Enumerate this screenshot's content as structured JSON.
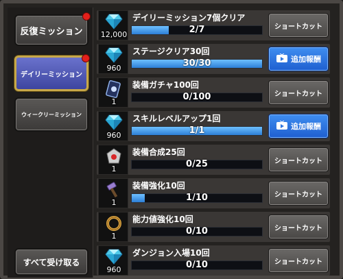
{
  "sidebar": {
    "tabs": [
      {
        "label": "反復ミッション",
        "active": false,
        "notification": true
      },
      {
        "label": "デイリーミッション",
        "active": true,
        "notification": true
      },
      {
        "label": "ウィークリーミッション",
        "active": false,
        "notification": false
      }
    ],
    "claim_all": "すべて受け取る"
  },
  "missions": [
    {
      "title": "デイリーミッション7個クリア",
      "icon": "diamond-icon",
      "qty": "12,000",
      "progress_text": "2/7",
      "progress": 0.286,
      "action": "ショートカット",
      "action_type": "shortcut"
    },
    {
      "title": "ステージクリア30回",
      "icon": "diamond-icon",
      "qty": "960",
      "progress_text": "30/30",
      "progress": 1.0,
      "action": "追加報酬",
      "action_type": "reward"
    },
    {
      "title": "装備ガチャ100回",
      "icon": "gacha-ticket-icon",
      "qty": "1",
      "progress_text": "0/100",
      "progress": 0.0,
      "action": "ショートカット",
      "action_type": "shortcut"
    },
    {
      "title": "スキルレベルアップ1回",
      "icon": "diamond-icon",
      "qty": "960",
      "progress_text": "1/1",
      "progress": 1.0,
      "action": "追加報酬",
      "action_type": "reward"
    },
    {
      "title": "装備合成25回",
      "icon": "synthesis-stone-icon",
      "qty": "1",
      "progress_text": "0/25",
      "progress": 0.0,
      "action": "ショートカット",
      "action_type": "shortcut"
    },
    {
      "title": "装備強化10回",
      "icon": "hammer-icon",
      "qty": "1",
      "progress_text": "1/10",
      "progress": 0.1,
      "action": "ショートカット",
      "action_type": "shortcut"
    },
    {
      "title": "能力値強化10回",
      "icon": "gold-ring-icon",
      "qty": "1",
      "progress_text": "0/10",
      "progress": 0.0,
      "action": "ショートカット",
      "action_type": "shortcut"
    },
    {
      "title": "ダンジョン入場10回",
      "icon": "diamond-icon",
      "qty": "960",
      "progress_text": "0/10",
      "progress": 0.0,
      "action": "ショートカット",
      "action_type": "shortcut"
    }
  ],
  "colors": {
    "accent": "#2d7fd6",
    "active_tab": "#4f58b8",
    "notification": "#e3201b",
    "reward_button": "#2f77e0"
  }
}
